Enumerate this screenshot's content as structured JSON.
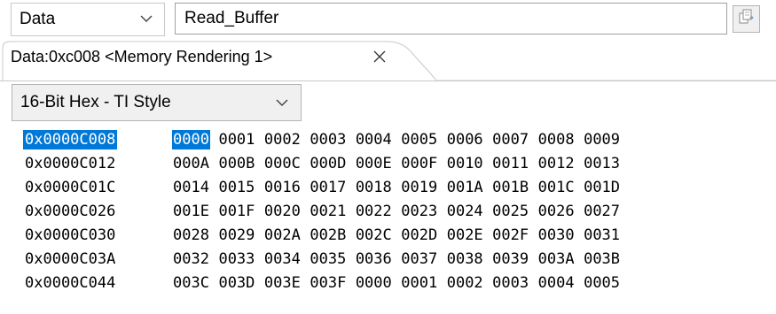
{
  "toolbar": {
    "memory_space": "Data",
    "address_expression": "Read_Buffer"
  },
  "tab": {
    "label": "Data:0xc008 <Memory Rendering 1>",
    "close_glyph": "✕"
  },
  "format": {
    "selected": "16-Bit Hex - TI Style"
  },
  "icons": {
    "space_dropdown": "chevron-down-icon",
    "go": "new-rendering-icon",
    "tab_close": "close-icon",
    "format_dropdown": "chevron-down-icon"
  },
  "colors": {
    "selection": "#0078d7",
    "selection_text": "#ffffff"
  },
  "memory": {
    "rows": [
      {
        "address": "0x0000C008",
        "cells": [
          "0000",
          "0001",
          "0002",
          "0003",
          "0004",
          "0005",
          "0006",
          "0007",
          "0008",
          "0009"
        ]
      },
      {
        "address": "0x0000C012",
        "cells": [
          "000A",
          "000B",
          "000C",
          "000D",
          "000E",
          "000F",
          "0010",
          "0011",
          "0012",
          "0013"
        ]
      },
      {
        "address": "0x0000C01C",
        "cells": [
          "0014",
          "0015",
          "0016",
          "0017",
          "0018",
          "0019",
          "001A",
          "001B",
          "001C",
          "001D"
        ]
      },
      {
        "address": "0x0000C026",
        "cells": [
          "001E",
          "001F",
          "0020",
          "0021",
          "0022",
          "0023",
          "0024",
          "0025",
          "0026",
          "0027"
        ]
      },
      {
        "address": "0x0000C030",
        "cells": [
          "0028",
          "0029",
          "002A",
          "002B",
          "002C",
          "002D",
          "002E",
          "002F",
          "0030",
          "0031"
        ]
      },
      {
        "address": "0x0000C03A",
        "cells": [
          "0032",
          "0033",
          "0034",
          "0035",
          "0036",
          "0037",
          "0038",
          "0039",
          "003A",
          "003B"
        ]
      },
      {
        "address": "0x0000C044",
        "cells": [
          "003C",
          "003D",
          "003E",
          "003F",
          "0000",
          "0001",
          "0002",
          "0003",
          "0004",
          "0005"
        ]
      }
    ],
    "selected_row": 0,
    "selected_cell": 0
  }
}
